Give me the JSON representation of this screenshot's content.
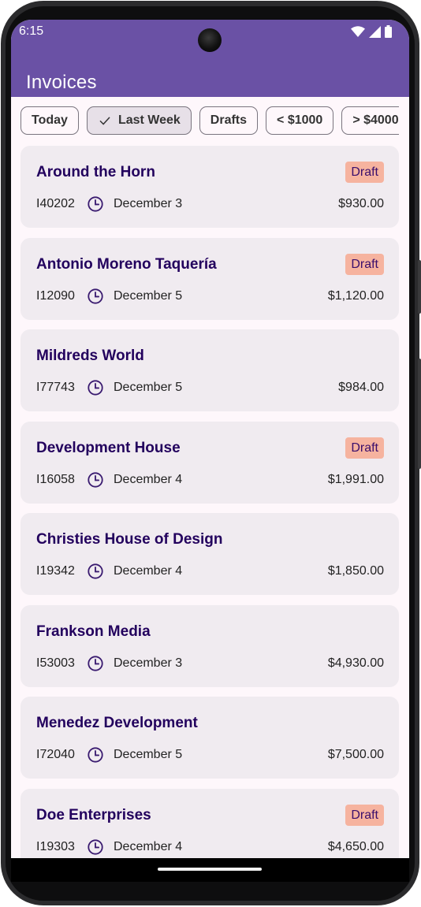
{
  "status": {
    "time": "6:15",
    "icons": [
      "wifi-icon",
      "signal-icon",
      "battery-icon"
    ]
  },
  "app": {
    "title": "Invoices"
  },
  "filters": [
    {
      "label": "Today",
      "selected": false
    },
    {
      "label": "Last Week",
      "selected": true
    },
    {
      "label": "Drafts",
      "selected": false
    },
    {
      "label": "< $1000",
      "selected": false
    },
    {
      "label": "> $4000",
      "selected": false
    }
  ],
  "invoices": [
    {
      "name": "Around the Horn",
      "id": "I40202",
      "date": "December 3",
      "amount": "$930.00",
      "badge": "Draft"
    },
    {
      "name": "Antonio Moreno Taquería",
      "id": "I12090",
      "date": "December 5",
      "amount": "$1,120.00",
      "badge": "Draft"
    },
    {
      "name": "Mildreds World",
      "id": "I77743",
      "date": "December 5",
      "amount": "$984.00",
      "badge": ""
    },
    {
      "name": "Development House",
      "id": "I16058",
      "date": "December 4",
      "amount": "$1,991.00",
      "badge": "Draft"
    },
    {
      "name": "Christies House of Design",
      "id": "I19342",
      "date": "December 4",
      "amount": "$1,850.00",
      "badge": ""
    },
    {
      "name": "Frankson Media",
      "id": "I53003",
      "date": "December 3",
      "amount": "$4,930.00",
      "badge": ""
    },
    {
      "name": "Menedez Development",
      "id": "I72040",
      "date": "December 5",
      "amount": "$7,500.00",
      "badge": ""
    },
    {
      "name": "Doe Enterprises",
      "id": "I19303",
      "date": "December 4",
      "amount": "$4,650.00",
      "badge": "Draft"
    }
  ],
  "colors": {
    "appbar": "#6a51a5",
    "title_text": "#22005d",
    "badge_bg": "#f6b39f",
    "card_bg": "#f0ebf0"
  }
}
